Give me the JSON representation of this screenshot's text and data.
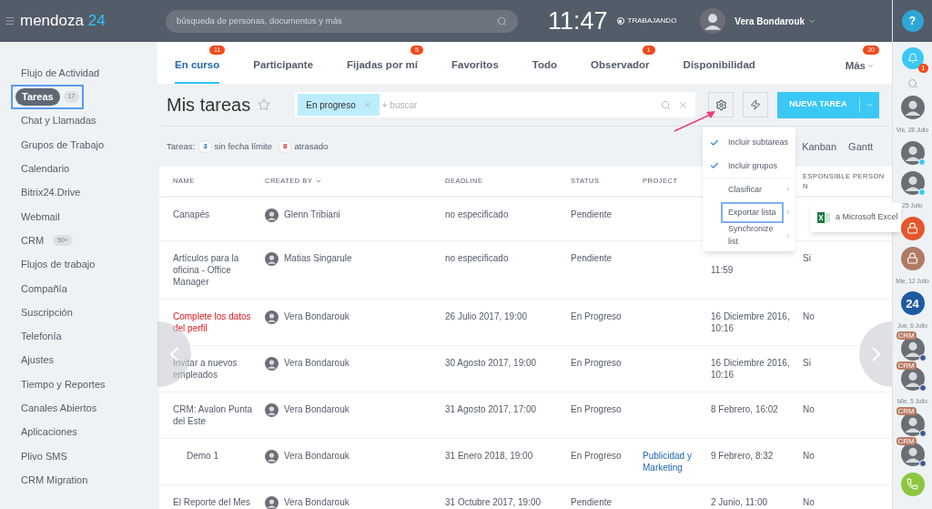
{
  "header": {
    "logo_text": "mendoza",
    "logo_number": "24",
    "search_placeholder": "búsqueda de personas, documentos y más",
    "time": "11:47",
    "status": "TRABAJANDO",
    "user": "Vera Bondarouk",
    "help": "?"
  },
  "sidebar": {
    "items": [
      {
        "label": "Flujo de Actividad",
        "selected": false
      },
      {
        "label": "Tareas",
        "selected": true,
        "counter": "17"
      },
      {
        "label": "Chat y Llamadas",
        "selected": false
      },
      {
        "label": "Grupos de Trabajo",
        "selected": false
      },
      {
        "label": "Calendario",
        "selected": false
      },
      {
        "label": "Bitrix24.Drive",
        "selected": false
      },
      {
        "label": "Webmail",
        "selected": false
      },
      {
        "label": "CRM",
        "selected": false,
        "counter": "50+"
      },
      {
        "label": "Flujos de trabajo",
        "selected": false
      },
      {
        "label": "Compañía",
        "selected": false
      },
      {
        "label": "Suscripción",
        "selected": false
      },
      {
        "label": "Telefonía",
        "selected": false
      },
      {
        "label": "Ajustes",
        "selected": false
      },
      {
        "label": "Tiempo y Reportes",
        "selected": false
      },
      {
        "label": "Canales Abiertos",
        "selected": false
      },
      {
        "label": "Aplicaciones",
        "selected": false
      },
      {
        "label": "Plivo SMS",
        "selected": false
      },
      {
        "label": "CRM Migration",
        "selected": false
      }
    ]
  },
  "tabs": [
    {
      "label": "En curso",
      "selected": true,
      "badge": "11"
    },
    {
      "label": "Participante",
      "selected": false
    },
    {
      "label": "Fijadas por mí",
      "selected": false,
      "badge": "5"
    },
    {
      "label": "Favoritos",
      "selected": false
    },
    {
      "label": "Todo",
      "selected": false
    },
    {
      "label": "Observador",
      "selected": false,
      "badge": "1"
    },
    {
      "label": "Disponibilidad",
      "selected": false
    }
  ],
  "more_tab": {
    "label": "Más",
    "badge": "20"
  },
  "page_title": "Mis tareas",
  "starred": false,
  "filter": {
    "tag": "En progreso",
    "placeholder": "+ buscar"
  },
  "new_button": "NUEVA TAREA",
  "counters": {
    "label": "Tareas:",
    "items": [
      {
        "count": "3",
        "label": "sin fecha límite",
        "kind": "info"
      },
      {
        "count": "8",
        "label": "atrasado",
        "kind": "alert"
      }
    ]
  },
  "views": [
    "Kanban",
    "Gantt"
  ],
  "menu": {
    "items": [
      {
        "label": "Incluir subtareas",
        "kind": "check",
        "checked": true,
        "selected": false
      },
      {
        "label": "Incluir grupos",
        "kind": "check",
        "checked": true,
        "selected": false
      },
      {
        "label": "Clasificar",
        "kind": "submenu",
        "selected": false
      },
      {
        "label": "Exportar lista",
        "kind": "submenu",
        "selected": true
      },
      {
        "label": "Synchronize list",
        "kind": "submenu",
        "selected": false
      }
    ],
    "submenu": {
      "label": "a Microsoft Excel"
    }
  },
  "table": {
    "columns": [
      "NAME",
      "CREATED BY",
      "DEADLINE",
      "STATUS",
      "PROJECT",
      "ESPONSIBLE PERSON N"
    ],
    "rows": [
      {
        "name": "Canapés",
        "overdue": false,
        "creator": "Glenn Tribiani",
        "deadline": "no especificado",
        "status": "Pendiente"
      },
      {
        "name": "Artículos para la oficina - Office Manager",
        "overdue": false,
        "creator": "Matias Singarule",
        "deadline": "no especificado",
        "status": "Pendiente",
        "changed": "11:59",
        "responsible": "Si"
      },
      {
        "name": "Complete los datos del perfil",
        "overdue": true,
        "creator": "Vera Bondarouk",
        "deadline": "26 Julio 2017, 19:00",
        "status": "En Progreso",
        "changed": "16 Diciembre 2016, 10:16",
        "responsible": "No"
      },
      {
        "name": "Invitar a nuevos empleados",
        "overdue": false,
        "creator": "Vera Bondarouk",
        "deadline": "30 Agosto 2017, 19:00",
        "status": "En Progreso",
        "changed": "16 Diciembre 2016, 10:16",
        "responsible": "Si"
      },
      {
        "name": "CRM: Avalon Punta del Este",
        "overdue": false,
        "creator": "Vera Bondarouk",
        "deadline": "31 Agosto 2017, 17:00",
        "status": "En Progreso",
        "changed": "8 Febrero, 16:02",
        "responsible": "No",
        "children": [
          {
            "name": "Demo 1",
            "overdue": false,
            "creator": "Vera Bondarouk",
            "deadline": "31 Enero 2018, 19:00",
            "status": "En Progreso",
            "project": "Publicidad y Marketing",
            "changed": "9 Febrero, 8:32",
            "responsible": "No"
          }
        ]
      },
      {
        "name": "El Reporte del Mes",
        "overdue": false,
        "creator": "Vera Bondarouk",
        "deadline": "31 Octubre 2017, 19:00",
        "status": "Pendiente",
        "changed": "2 Junio, 11:00",
        "responsible": "No"
      }
    ]
  },
  "rail": {
    "notification_badge": "1",
    "items": [
      {
        "kind": "avatar"
      },
      {
        "kind": "date",
        "label": "Vie, 28 Julio"
      },
      {
        "kind": "avatar",
        "online": true
      },
      {
        "kind": "avatar",
        "online": true
      },
      {
        "kind": "date",
        "label": "25 Julio"
      },
      {
        "kind": "lock",
        "color": "#e4572e"
      },
      {
        "kind": "lock",
        "color": "#b07a63"
      },
      {
        "kind": "date",
        "label": "Mie, 12 Julio"
      },
      {
        "kind": "logo",
        "label": "24"
      },
      {
        "kind": "date",
        "label": "Jue, 6 Julio"
      },
      {
        "kind": "crm",
        "tag": "CRM"
      },
      {
        "kind": "crm",
        "tag": "CRM"
      },
      {
        "kind": "date",
        "label": "Mie, 5 Julio"
      },
      {
        "kind": "crm",
        "tag": "CRM"
      },
      {
        "kind": "crm",
        "tag": "CRM"
      },
      {
        "kind": "phone"
      }
    ]
  }
}
